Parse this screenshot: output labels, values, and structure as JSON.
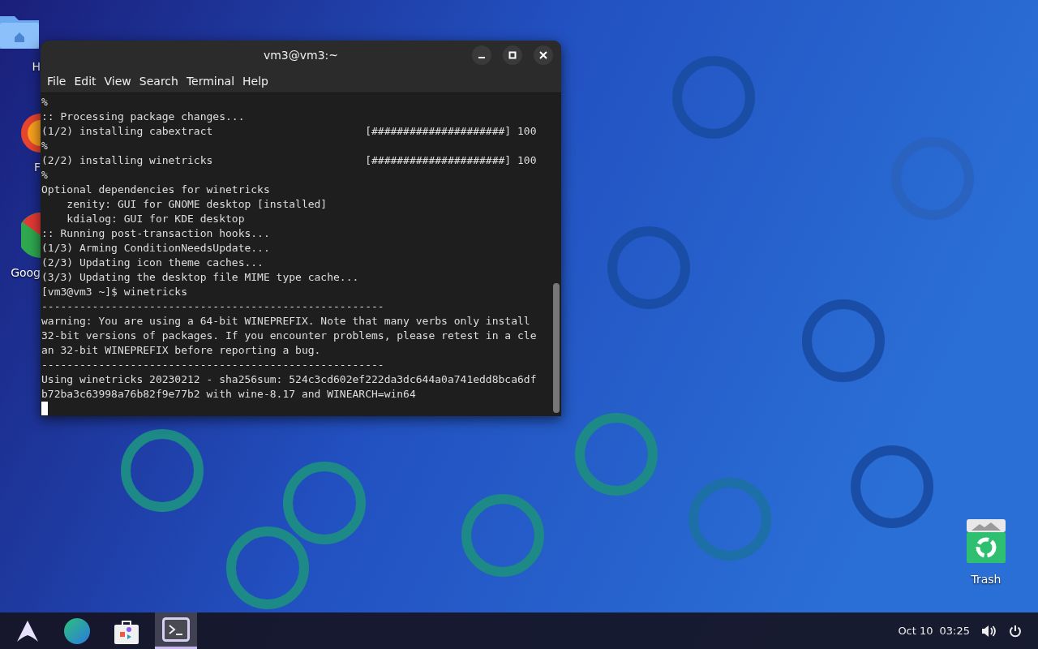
{
  "desktop_icons": [
    {
      "kind": "folder",
      "label": "H"
    },
    {
      "kind": "browser",
      "label": "F"
    },
    {
      "kind": "chrome",
      "label": "Goog"
    },
    {
      "kind": "trash",
      "label": "Trash"
    }
  ],
  "window": {
    "title": "vm3@vm3:~",
    "controls": [
      {
        "kind": "minimize"
      },
      {
        "kind": "maximize"
      },
      {
        "kind": "close"
      }
    ]
  },
  "menu": [
    "File",
    "Edit",
    "View",
    "Search",
    "Terminal",
    "Help"
  ],
  "terminal_lines": [
    "%",
    ":: Processing package changes...",
    "(1/2) installing cabextract                        [#####################] 100",
    "%",
    "(2/2) installing winetricks                        [#####################] 100",
    "%",
    "Optional dependencies for winetricks",
    "    zenity: GUI for GNOME desktop [installed]",
    "    kdialog: GUI for KDE desktop",
    ":: Running post-transaction hooks...",
    "(1/3) Arming ConditionNeedsUpdate...",
    "(2/3) Updating icon theme caches...",
    "(3/3) Updating the desktop file MIME type cache...",
    "[vm3@vm3 ~]$ winetricks",
    "------------------------------------------------------",
    "warning: You are using a 64-bit WINEPREFIX. Note that many verbs only install",
    "32-bit versions of packages. If you encounter problems, please retest in a cle",
    "an 32-bit WINEPREFIX before reporting a bug.",
    "------------------------------------------------------",
    "Using winetricks 20230212 - sha256sum: 524c3cd602ef222da3dc644a0a741edd8bca6df",
    "b72ba3c63998a76b82f9e77b2 with wine-8.17 and WINEARCH=win64"
  ],
  "taskbar": {
    "apps": [
      {
        "kind": "launcher",
        "selected": false
      },
      {
        "kind": "globe",
        "selected": false
      },
      {
        "kind": "store",
        "selected": false
      },
      {
        "kind": "terminal",
        "selected": true
      }
    ],
    "date": "Oct 10",
    "time": "03:25"
  }
}
